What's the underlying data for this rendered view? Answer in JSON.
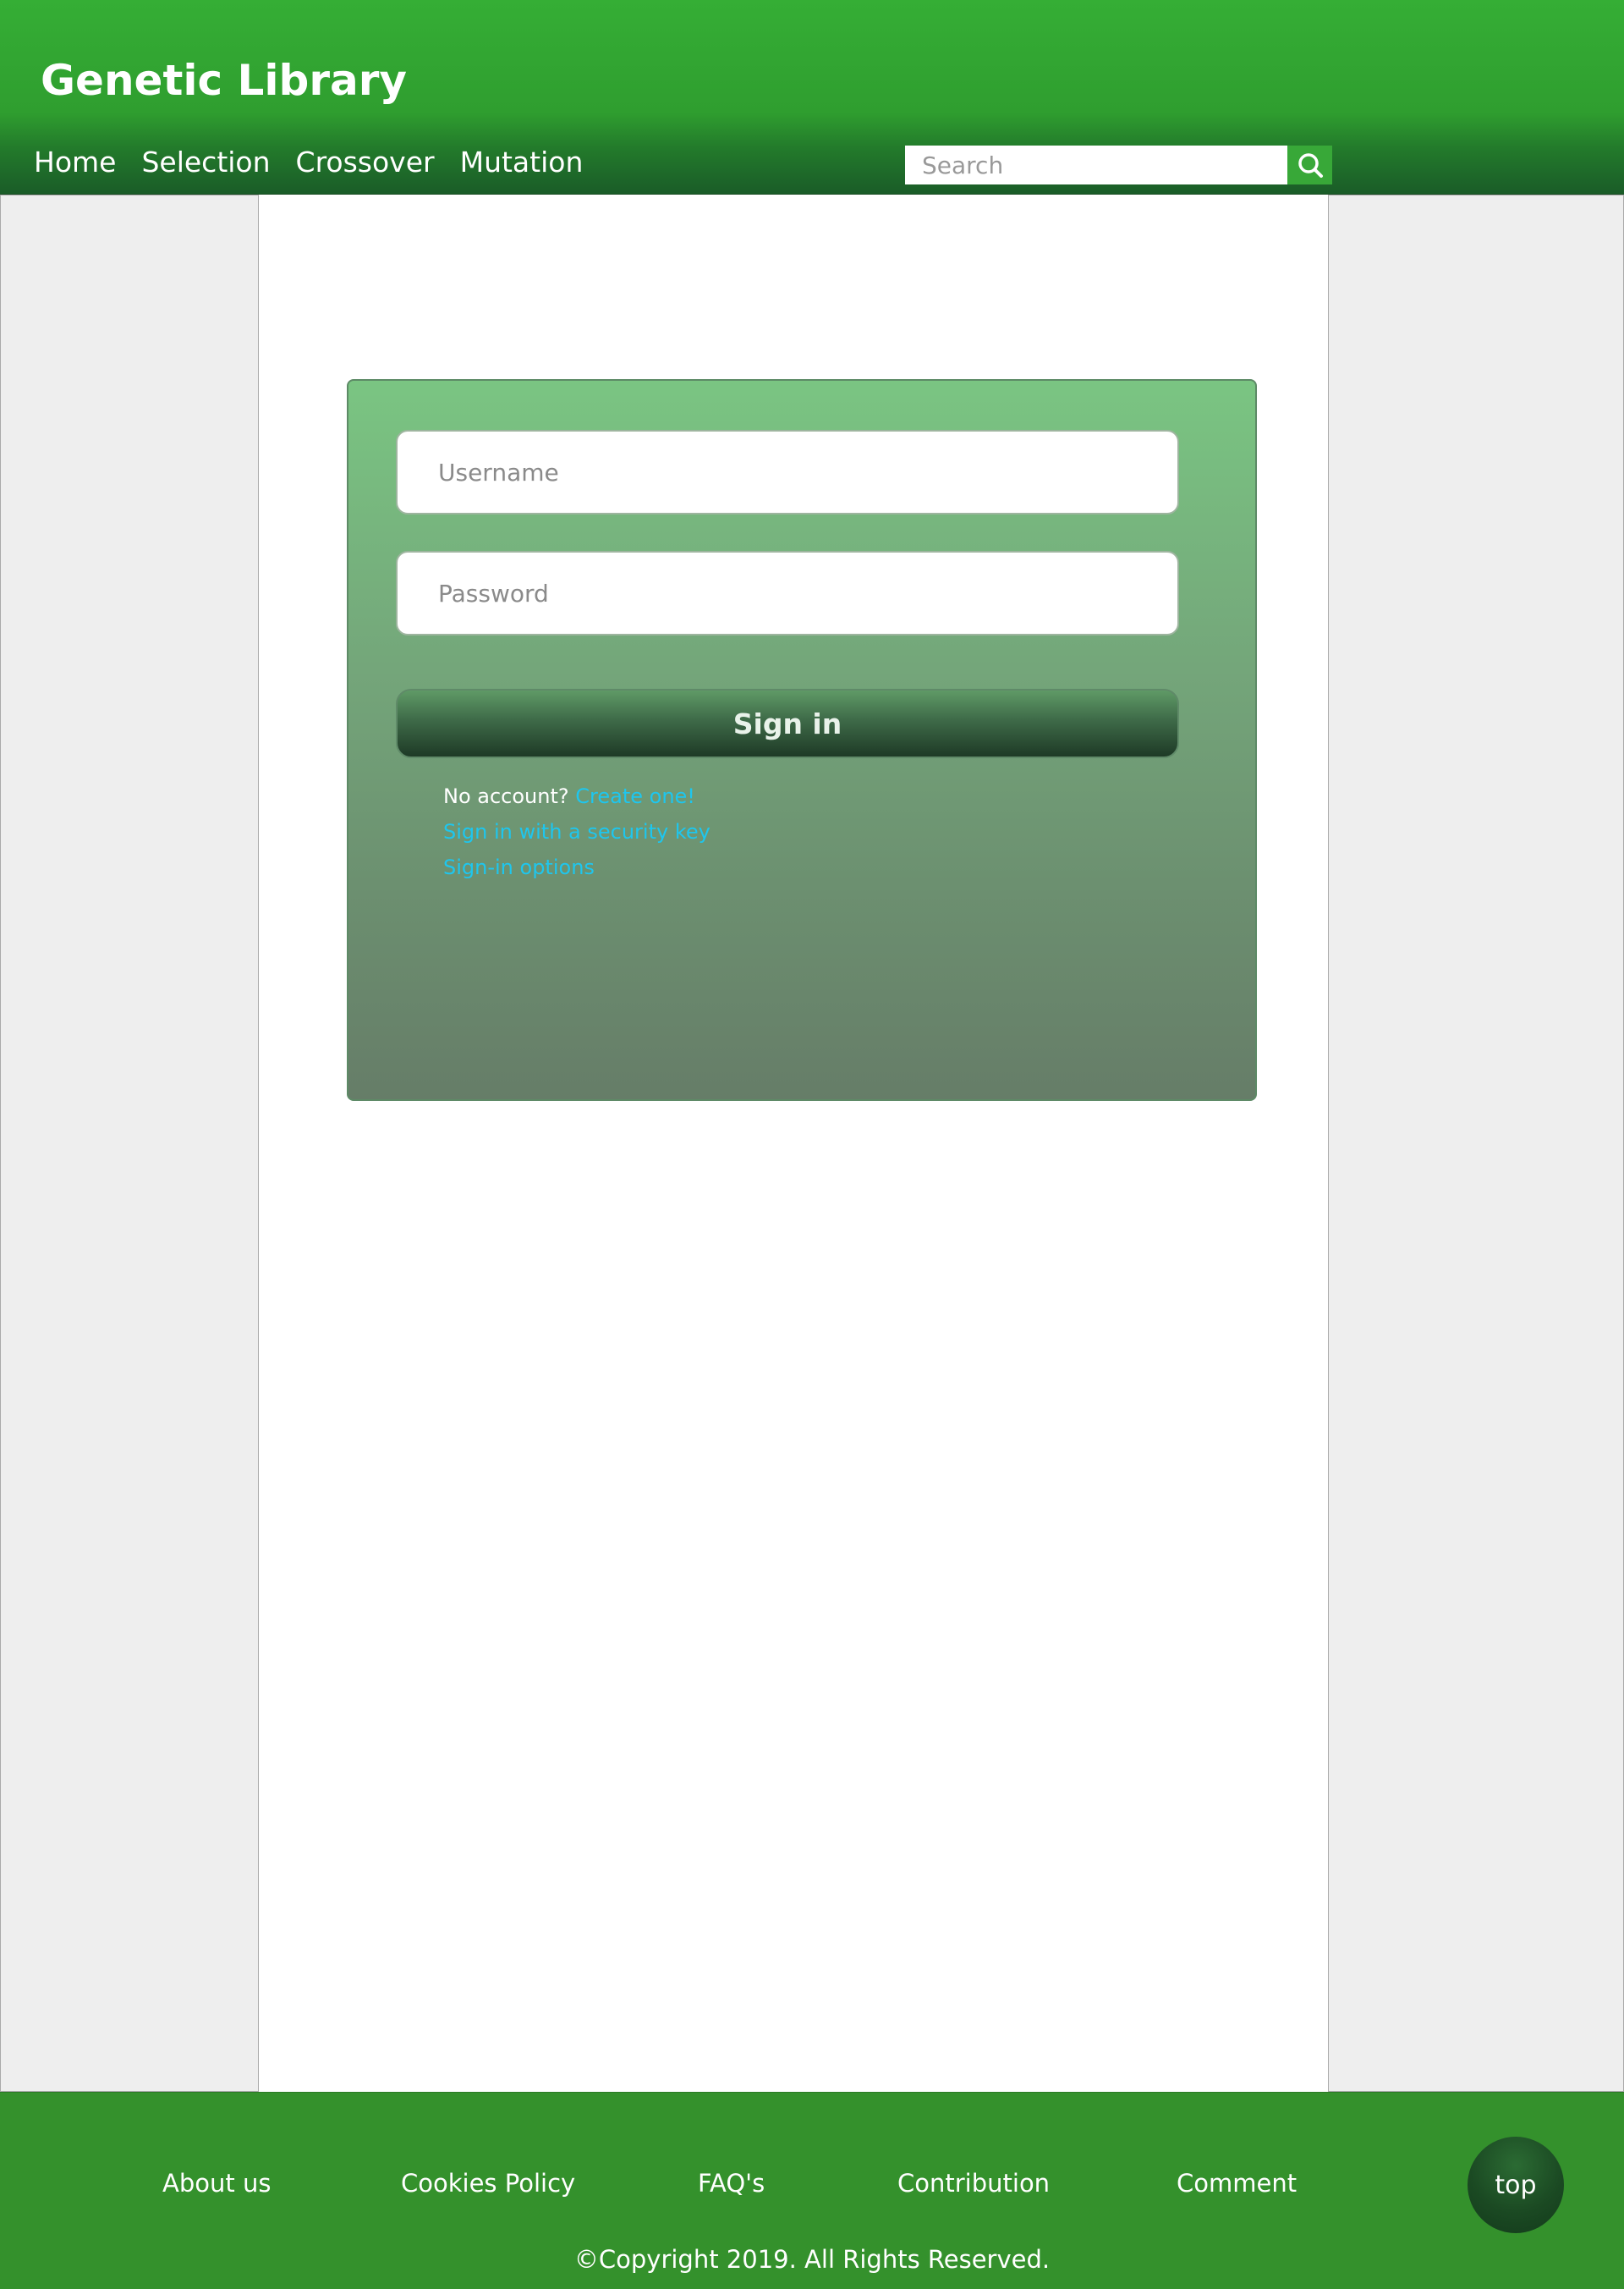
{
  "header": {
    "title": "Genetic Library",
    "nav": [
      "Home",
      "Selection",
      "Crossover",
      "Mutation"
    ],
    "search": {
      "placeholder": "Search",
      "icon": "search-icon"
    }
  },
  "login": {
    "username_placeholder": "Username",
    "password_placeholder": "Password",
    "sign_in_label": "Sign in",
    "no_account_text": "No account?",
    "create_link": "Create one!",
    "security_key_link": "Sign in with a security key",
    "options_link": "Sign-in options"
  },
  "footer": {
    "links": [
      "About us",
      "Cookies Policy",
      "FAQ's",
      "Contribution",
      "Comment"
    ],
    "copyright": "©Copyright 2019. All Rights Reserved.",
    "top_label": "top"
  },
  "colors": {
    "header_green": "#35ae35",
    "footer_green": "#34912c",
    "link_cyan": "#1ec6ee",
    "side_gray": "#eeeeee"
  }
}
